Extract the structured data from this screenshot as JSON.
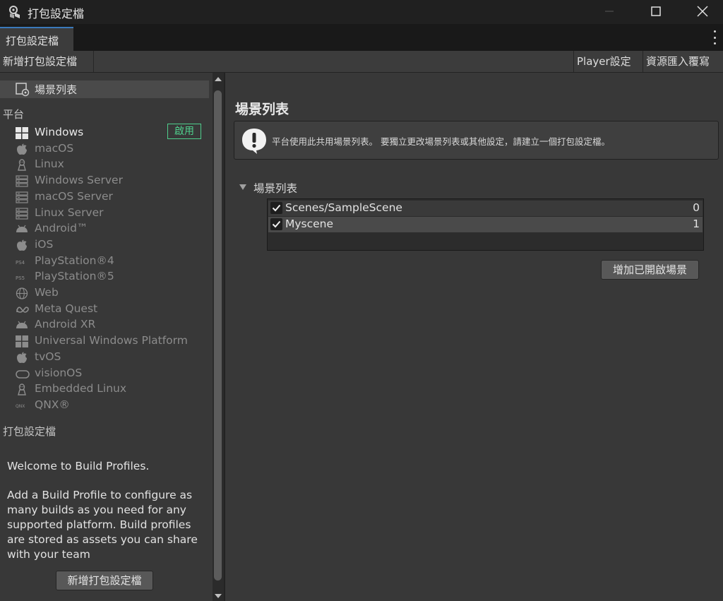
{
  "window": {
    "title": "打包設定檔",
    "controls": [
      "minimize-icon",
      "maximize-icon",
      "close-icon"
    ]
  },
  "tab": {
    "label": "打包設定檔"
  },
  "toolbar": {
    "new_profile": "新增打包設定檔",
    "player_settings": "Player設定",
    "asset_import_overrides": "資源匯入覆寫"
  },
  "sidebar": {
    "scene_list_label": "場景列表",
    "platforms_header": "平台",
    "enabled_badge": "啟用",
    "platforms": [
      {
        "name": "Windows",
        "icon": "windows-icon",
        "active": true
      },
      {
        "name": "macOS",
        "icon": "apple-icon"
      },
      {
        "name": "Linux",
        "icon": "linux-icon"
      },
      {
        "name": "Windows Server",
        "icon": "server-icon"
      },
      {
        "name": "macOS Server",
        "icon": "server-icon"
      },
      {
        "name": "Linux Server",
        "icon": "server-icon"
      },
      {
        "name": "Android™",
        "icon": "android-icon"
      },
      {
        "name": "iOS",
        "icon": "apple-icon"
      },
      {
        "name": "PlayStation®4",
        "icon": "ps4-icon"
      },
      {
        "name": "PlayStation®5",
        "icon": "ps5-icon"
      },
      {
        "name": "Web",
        "icon": "globe-icon"
      },
      {
        "name": "Meta Quest",
        "icon": "meta-icon"
      },
      {
        "name": "Android XR",
        "icon": "android-icon"
      },
      {
        "name": "Universal Windows Platform",
        "icon": "windows-icon"
      },
      {
        "name": "tvOS",
        "icon": "apple-icon"
      },
      {
        "name": "visionOS",
        "icon": "vision-icon"
      },
      {
        "name": "Embedded Linux",
        "icon": "linux-icon"
      },
      {
        "name": "QNX®",
        "icon": "qnx-icon"
      }
    ],
    "profiles_header": "打包設定檔",
    "welcome_title": "Welcome to Build Profiles.",
    "welcome_body": "Add a Build Profile to configure as many builds as you need for any supported platform. Build profiles are stored as assets you can share with your team",
    "welcome_button": "新增打包設定檔"
  },
  "main": {
    "title": "場景列表",
    "help_text": "平台使用此共用場景列表。 要獨立更改場景列表或其他設定，請建立一個打包設定檔。",
    "foldout_label": "場景列表",
    "scenes": [
      {
        "name": "Scenes/SampleScene",
        "index": "0",
        "checked": true
      },
      {
        "name": "Myscene",
        "index": "1",
        "checked": true
      }
    ],
    "add_open_scenes": "增加已開啟場景"
  },
  "colors": {
    "accent_green": "#4fce8c",
    "tab_accent": "#3a79bb",
    "background": "#383838"
  }
}
